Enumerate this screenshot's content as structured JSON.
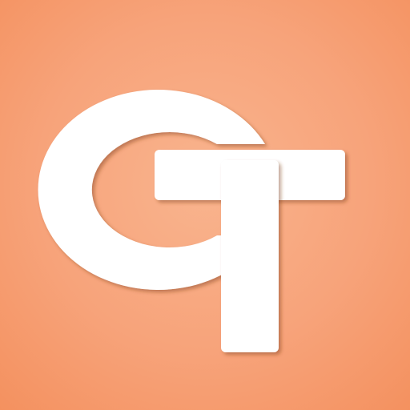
{
  "icon": {
    "name": "app-logo",
    "glyph": "CT monogram",
    "colors": {
      "background_light": "#f9b48e",
      "background_mid": "#f7a37a",
      "background_dark": "#f4915f",
      "mark": "#ffffff"
    }
  }
}
